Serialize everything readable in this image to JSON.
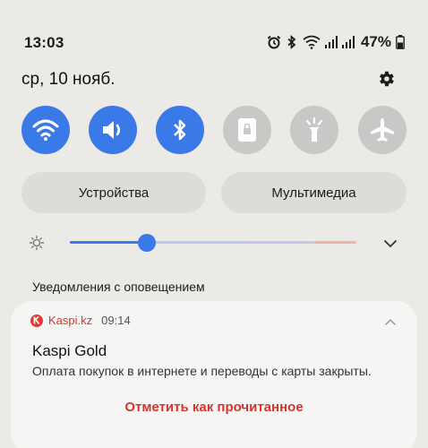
{
  "status_bar": {
    "time": "13:03",
    "battery_percent": "47%",
    "icons": [
      "alarm-icon",
      "bluetooth-icon",
      "wifi-icon",
      "signal-icon",
      "signal-icon",
      "battery-icon"
    ]
  },
  "date": "ср, 10 нояб.",
  "quick_settings": [
    {
      "name": "wifi",
      "icon": "wifi-icon",
      "state": "on"
    },
    {
      "name": "sound",
      "icon": "speaker-icon",
      "state": "on"
    },
    {
      "name": "bluetooth",
      "icon": "bluetooth-icon",
      "state": "on"
    },
    {
      "name": "auto-rotate",
      "icon": "rotate-lock-icon",
      "state": "off"
    },
    {
      "name": "flashlight",
      "icon": "flashlight-icon",
      "state": "off"
    },
    {
      "name": "airplane",
      "icon": "airplane-icon",
      "state": "off"
    }
  ],
  "pills": {
    "devices": "Устройства",
    "media": "Мультимедиа"
  },
  "brightness": {
    "level": 0.27
  },
  "notifications_section_label": "Уведомления с оповещением",
  "notification": {
    "app_name": "Kaspi.kz",
    "time": "09:14",
    "title": "Kaspi Gold",
    "body": "Оплата покупок в интернете и переводы с карты закрыты.",
    "action": "Отметить как прочитанное"
  },
  "colors": {
    "accent": "#3a79e8",
    "kaspi_red": "#d2362e",
    "background": "#eceae6"
  }
}
